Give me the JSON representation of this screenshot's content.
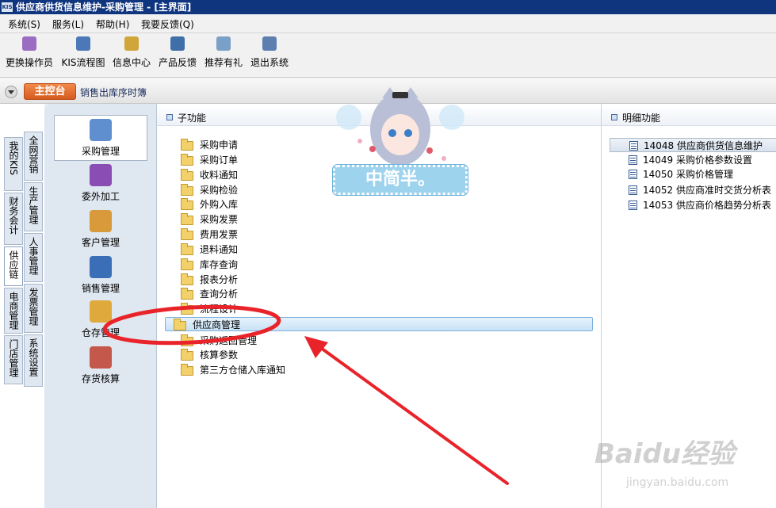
{
  "window": {
    "title": "供应商供货信息维护-采购管理 - [主界面]",
    "app_icon_text": "KIS"
  },
  "menu": [
    "系统(S)",
    "服务(L)",
    "帮助(H)",
    "我要反馈(Q)"
  ],
  "toolbar": [
    {
      "label": "更换操作员",
      "icon": "users-icon",
      "color": "#9a6cc2"
    },
    {
      "label": "KIS流程图",
      "icon": "flowchart-icon",
      "color": "#4d78b8"
    },
    {
      "label": "信息中心",
      "icon": "chat-bubble-icon",
      "color": "#d0a63a"
    },
    {
      "label": "产品反馈",
      "icon": "feedback-icon",
      "color": "#3f6fa8"
    },
    {
      "label": "推荐有礼",
      "icon": "gift-icon",
      "color": "#7aa0c8"
    },
    {
      "label": "退出系统",
      "icon": "exit-icon",
      "color": "#5c7fb0"
    }
  ],
  "nav": {
    "console": "主控台",
    "tab": "销售出库序时簿"
  },
  "vertical_tabs": {
    "col1": [
      "我的KIS",
      "财务会计",
      "供应链",
      "电商管理",
      "门店管理"
    ],
    "col2": [
      "全网营销",
      "生产管理",
      "人事管理",
      "发票管理",
      "系统设置"
    ],
    "active": "供应链"
  },
  "modules": [
    {
      "label": "采购管理",
      "icon": "purchase-icon",
      "color": "#5f8fcf",
      "active": true
    },
    {
      "label": "委外加工",
      "icon": "outsource-icon",
      "color": "#8a4db3"
    },
    {
      "label": "客户管理",
      "icon": "customer-icon",
      "color": "#d89a3a"
    },
    {
      "label": "销售管理",
      "icon": "sales-truck-icon",
      "color": "#3a6fb8"
    },
    {
      "label": "仓存管理",
      "icon": "warehouse-icon",
      "color": "#e0a93c"
    },
    {
      "label": "存货核算",
      "icon": "inventory-chart-icon",
      "color": "#c4584a"
    }
  ],
  "subfunctions": {
    "header": "子功能",
    "items": [
      "采购申请",
      "采购订单",
      "收料通知",
      "采购检验",
      "外购入库",
      "采购发票",
      "费用发票",
      "退料通知",
      "库存查询",
      "报表分析",
      "查询分析",
      "流程设计",
      "供应商管理",
      "采购返回管理",
      "核算参数",
      "第三方仓储入库通知"
    ],
    "selected": "供应商管理"
  },
  "details": {
    "header": "明细功能",
    "items": [
      {
        "code": "14048",
        "name": "供应商供货信息维护",
        "selected": true
      },
      {
        "code": "14049",
        "name": "采购价格参数设置"
      },
      {
        "code": "14050",
        "name": "采购价格管理"
      },
      {
        "code": "14052",
        "name": "供应商准时交货分析表"
      },
      {
        "code": "14053",
        "name": "供应商价格趋势分析表"
      }
    ]
  },
  "sticker": {
    "text": "中简半。"
  },
  "watermark": {
    "brand": "Baidu经验",
    "url": "jingyan.baidu.com"
  },
  "colors": {
    "title_bar": "#10357f",
    "console_button": "#e1692c",
    "annotation": "#e8242a",
    "selection": "#c8e2f7"
  }
}
